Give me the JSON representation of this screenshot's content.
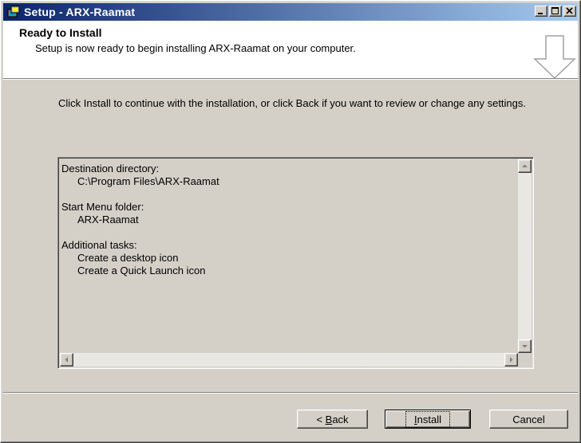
{
  "window": {
    "title": "Setup - ARX-Raamat",
    "controls": [
      "minimize-icon",
      "maximize-icon",
      "close-icon"
    ]
  },
  "header": {
    "title": "Ready to Install",
    "subtitle": "Setup is now ready to begin installing ARX-Raamat on your computer.",
    "graphic": "down-arrow-icon"
  },
  "main": {
    "instruction": "Click Install to continue with the installation, or click Back if you want to review or change any settings.",
    "memo": {
      "lines": [
        {
          "text": "Destination directory:",
          "indent": false
        },
        {
          "text": "C:\\Program Files\\ARX-Raamat",
          "indent": true
        },
        {
          "text": "",
          "indent": false
        },
        {
          "text": "Start Menu folder:",
          "indent": false
        },
        {
          "text": "ARX-Raamat",
          "indent": true
        },
        {
          "text": "",
          "indent": false
        },
        {
          "text": "Additional tasks:",
          "indent": false
        },
        {
          "text": "Create a desktop icon",
          "indent": true
        },
        {
          "text": "Create a Quick Launch icon",
          "indent": true
        }
      ]
    }
  },
  "buttons": {
    "back": {
      "prefix": "< ",
      "accel": "B",
      "rest": "ack"
    },
    "install": {
      "accel": "I",
      "rest": "nstall"
    },
    "cancel": "Cancel"
  },
  "colors": {
    "titlebar_start": "#0a246a",
    "titlebar_end": "#a6caf0",
    "face": "#d4d0c8"
  }
}
